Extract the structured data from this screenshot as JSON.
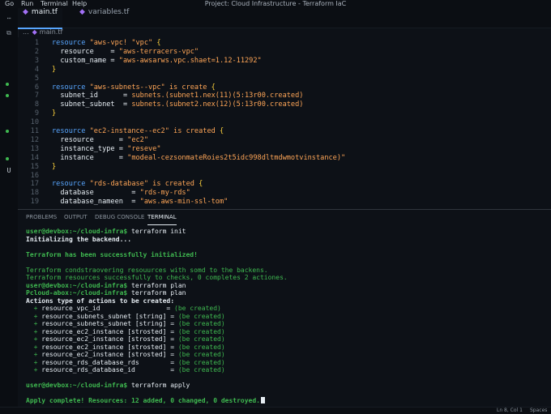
{
  "menubar": {
    "items": [
      "Go",
      "Run",
      "Terminal",
      "Help"
    ],
    "window_title": "Project: Cloud Infrastructure - Terraform IaC"
  },
  "activity_bar": {
    "icons": [
      "more-icon",
      "copy-icon"
    ],
    "badge": "U"
  },
  "tabs": [
    {
      "label": "main.tf",
      "active": true
    },
    {
      "label": "variables.tf",
      "active": false
    }
  ],
  "breadcrumb": {
    "dots": "...",
    "file": "main.tf"
  },
  "editor": {
    "lines": [
      {
        "n": "1",
        "segs": [
          [
            "kw",
            "resource "
          ],
          [
            "str",
            "\"aws-vpc! \"vpc\" "
          ],
          [
            "brace",
            "{"
          ]
        ]
      },
      {
        "n": "2",
        "segs": [
          [
            "id",
            "  resource    = "
          ],
          [
            "str",
            "\"aws-terracers-vpc\""
          ]
        ]
      },
      {
        "n": "3",
        "segs": [
          [
            "id",
            "  custom_name = "
          ],
          [
            "str",
            "\"aws-awsarws.vpc.shaet=1.12-11292\""
          ]
        ]
      },
      {
        "n": "4",
        "segs": [
          [
            "brace",
            "}"
          ]
        ]
      },
      {
        "n": "5",
        "segs": []
      },
      {
        "n": "6",
        "segs": [
          [
            "kw",
            "resource "
          ],
          [
            "str",
            "\"aws-subnets--vpc\" is create "
          ],
          [
            "brace",
            "{"
          ]
        ]
      },
      {
        "n": "7",
        "segs": [
          [
            "id",
            "  subnet_id      = "
          ],
          [
            "str",
            "subnets.(subnet1.nex(11)(5:13r00.created)"
          ]
        ]
      },
      {
        "n": "8",
        "segs": [
          [
            "id",
            "  subnet_subnet  = "
          ],
          [
            "str",
            "subnets.(subnet2.nex(12)(5:13r00.created)"
          ]
        ]
      },
      {
        "n": "9",
        "segs": [
          [
            "brace",
            "}"
          ]
        ]
      },
      {
        "n": "10",
        "segs": []
      },
      {
        "n": "11",
        "segs": [
          [
            "kw",
            "resource "
          ],
          [
            "str",
            "\"ec2-instance--ec2\" is created "
          ],
          [
            "brace",
            "{"
          ]
        ]
      },
      {
        "n": "12",
        "segs": [
          [
            "id",
            "  resource      = "
          ],
          [
            "str",
            "\"ec2\""
          ]
        ]
      },
      {
        "n": "13",
        "segs": [
          [
            "id",
            "  instance_type = "
          ],
          [
            "str",
            "\"reseve\""
          ]
        ]
      },
      {
        "n": "14",
        "segs": [
          [
            "id",
            "  instance      = "
          ],
          [
            "str",
            "\"modeal-cezsonmateRoies2t5idc998dltmdwmotvinstance)\""
          ]
        ]
      },
      {
        "n": "15",
        "segs": [
          [
            "brace",
            "}"
          ]
        ]
      },
      {
        "n": "16",
        "segs": []
      },
      {
        "n": "17",
        "segs": [
          [
            "kw",
            "resource "
          ],
          [
            "str",
            "\"rds-database\" is created "
          ],
          [
            "brace",
            "{"
          ]
        ]
      },
      {
        "n": "18",
        "segs": [
          [
            "id",
            "  database         = "
          ],
          [
            "str",
            "\"rds-my-rds\""
          ]
        ]
      },
      {
        "n": "19",
        "segs": [
          [
            "id",
            "  database_nameen  = "
          ],
          [
            "str",
            "\"aws.aws-min-ssl-tom\""
          ]
        ]
      }
    ]
  },
  "panel": {
    "tabs": [
      "PROBLEMS",
      "OUTPUT",
      "DEBUG CONSOLE",
      "TERMINAL"
    ],
    "active_tab": "TERMINAL",
    "terminal_lines": [
      {
        "segs": [
          [
            "green bold",
            "user@devbox:~/cloud-infra$"
          ],
          [
            "white",
            " terraform init"
          ]
        ]
      },
      {
        "segs": [
          [
            "white bold",
            "Initializing the backend..."
          ]
        ]
      },
      {
        "segs": []
      },
      {
        "segs": [
          [
            "green bold",
            "Terraform has been successfully initialized!"
          ]
        ]
      },
      {
        "segs": []
      },
      {
        "segs": [
          [
            "green",
            "Terraform condstraovering resouurces with somd to the backens."
          ]
        ]
      },
      {
        "segs": [
          [
            "green",
            "Terraform resources successfully to checks, 0 completes 2 actiones."
          ]
        ]
      },
      {
        "segs": [
          [
            "green bold",
            "user@devbox:~/cloud-infra$"
          ],
          [
            "white",
            " terraform plan"
          ]
        ]
      },
      {
        "segs": [
          [
            "green bold",
            "Pcloud-abox:~/cloud-infra$"
          ],
          [
            "white",
            " terraform plan"
          ]
        ]
      },
      {
        "segs": [
          [
            "white bold",
            "Actions type of actions to be created:"
          ]
        ]
      },
      {
        "segs": [
          [
            "green",
            "  + "
          ],
          [
            "white",
            "resource_vpc_id                 = "
          ],
          [
            "green",
            "(be created)"
          ]
        ]
      },
      {
        "segs": [
          [
            "green",
            "  + "
          ],
          [
            "white",
            "resource_subnets_subnet [string] = "
          ],
          [
            "green",
            "(be created)"
          ]
        ]
      },
      {
        "segs": [
          [
            "green",
            "  + "
          ],
          [
            "white",
            "resource_subnets_subnet [string] = "
          ],
          [
            "green",
            "(be created)"
          ]
        ]
      },
      {
        "segs": [
          [
            "green",
            "  + "
          ],
          [
            "white",
            "resource_ec2_instance [strosted] = "
          ],
          [
            "green",
            "(be created)"
          ]
        ]
      },
      {
        "segs": [
          [
            "green",
            "  + "
          ],
          [
            "white",
            "resource_ec2_instance [strosted] = "
          ],
          [
            "green",
            "(be created)"
          ]
        ]
      },
      {
        "segs": [
          [
            "green",
            "  + "
          ],
          [
            "white",
            "resource_ec2_instance [strosted] = "
          ],
          [
            "green",
            "(be created)"
          ]
        ]
      },
      {
        "segs": [
          [
            "green",
            "  + "
          ],
          [
            "white",
            "resource_ec2_instance [strosted] = "
          ],
          [
            "green",
            "(be created)"
          ]
        ]
      },
      {
        "segs": [
          [
            "green",
            "  + "
          ],
          [
            "white",
            "resource_rds_database_rds        = "
          ],
          [
            "green",
            "(be created)"
          ]
        ]
      },
      {
        "segs": [
          [
            "green",
            "  + "
          ],
          [
            "white",
            "resource_rds_database_id         = "
          ],
          [
            "green",
            "(be created)"
          ]
        ]
      },
      {
        "segs": []
      },
      {
        "segs": [
          [
            "green bold",
            "user@devbox:~/cloud-infra$"
          ],
          [
            "white",
            " terraform apply"
          ]
        ]
      },
      {
        "segs": []
      },
      {
        "segs": [
          [
            "green bold",
            "Apply complete! Resources: 12 added, 0 changed, 0 destroyed."
          ]
        ],
        "cursor": true
      }
    ]
  },
  "statusbar": {
    "position": "Ln 8, Col 1",
    "indent": "Spaces"
  }
}
